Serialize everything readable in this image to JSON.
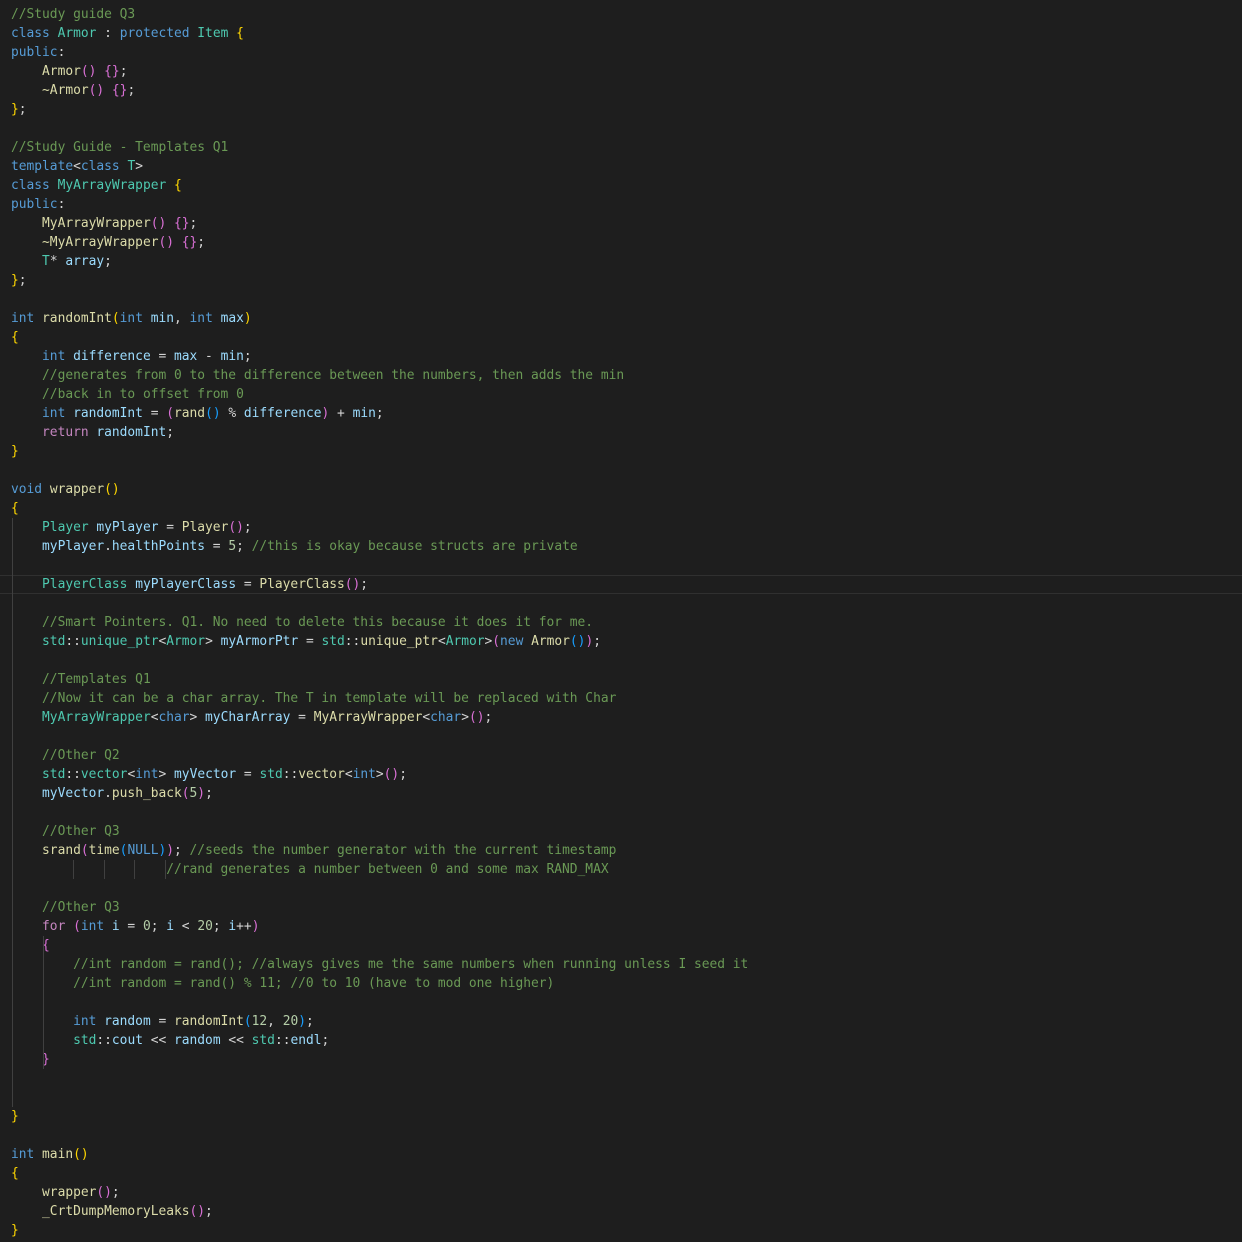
{
  "editor": {
    "language": "cpp",
    "theme_colors": {
      "background": "#1e1e1e",
      "comment": "#6a9955",
      "keyword": "#569cd6",
      "control": "#c586c0",
      "type": "#4ec9b0",
      "function": "#dcdcaa",
      "variable": "#9cdcfe",
      "number": "#b5cea8",
      "text": "#d4d4d4",
      "bracket_1": "#ffd700",
      "bracket_2": "#da70d6",
      "bracket_3": "#179fff"
    },
    "current_line": 30,
    "lines": [
      [
        [
          "c",
          "//Study guide Q3"
        ]
      ],
      [
        [
          "k",
          "class "
        ],
        [
          "y",
          "Armor"
        ],
        [
          "t",
          " : "
        ],
        [
          "k",
          "protected "
        ],
        [
          "y",
          "Item "
        ],
        [
          "b1",
          "{"
        ]
      ],
      [
        [
          "k",
          "public"
        ],
        [
          "t",
          ":"
        ]
      ],
      [
        [
          "t",
          "    "
        ],
        [
          "f",
          "Armor"
        ],
        [
          "b2",
          "()"
        ],
        [
          "t",
          " "
        ],
        [
          "b2",
          "{}"
        ],
        [
          "t",
          ";"
        ]
      ],
      [
        [
          "t",
          "    "
        ],
        [
          "f",
          "~Armor"
        ],
        [
          "b2",
          "()"
        ],
        [
          "t",
          " "
        ],
        [
          "b2",
          "{}"
        ],
        [
          "t",
          ";"
        ]
      ],
      [
        [
          "b1",
          "}"
        ],
        [
          "t",
          ";"
        ]
      ],
      [],
      [
        [
          "c",
          "//Study Guide - Templates Q1"
        ]
      ],
      [
        [
          "k",
          "template"
        ],
        [
          "t",
          "<"
        ],
        [
          "k",
          "class "
        ],
        [
          "y",
          "T"
        ],
        [
          "t",
          ">"
        ]
      ],
      [
        [
          "k",
          "class "
        ],
        [
          "y",
          "MyArrayWrapper "
        ],
        [
          "b1",
          "{"
        ]
      ],
      [
        [
          "k",
          "public"
        ],
        [
          "t",
          ":"
        ]
      ],
      [
        [
          "t",
          "    "
        ],
        [
          "f",
          "MyArrayWrapper"
        ],
        [
          "b2",
          "()"
        ],
        [
          "t",
          " "
        ],
        [
          "b2",
          "{}"
        ],
        [
          "t",
          ";"
        ]
      ],
      [
        [
          "t",
          "    "
        ],
        [
          "f",
          "~MyArrayWrapper"
        ],
        [
          "b2",
          "()"
        ],
        [
          "t",
          " "
        ],
        [
          "b2",
          "{}"
        ],
        [
          "t",
          ";"
        ]
      ],
      [
        [
          "t",
          "    "
        ],
        [
          "y",
          "T"
        ],
        [
          "t",
          "* "
        ],
        [
          "v",
          "array"
        ],
        [
          "t",
          ";"
        ]
      ],
      [
        [
          "b1",
          "}"
        ],
        [
          "t",
          ";"
        ]
      ],
      [],
      [
        [
          "k",
          "int "
        ],
        [
          "f",
          "randomInt"
        ],
        [
          "b1",
          "("
        ],
        [
          "k",
          "int "
        ],
        [
          "v",
          "min"
        ],
        [
          "t",
          ", "
        ],
        [
          "k",
          "int "
        ],
        [
          "v",
          "max"
        ],
        [
          "b1",
          ")"
        ]
      ],
      [
        [
          "b1",
          "{"
        ]
      ],
      [
        [
          "t",
          "    "
        ],
        [
          "k",
          "int "
        ],
        [
          "v",
          "difference"
        ],
        [
          "t",
          " = "
        ],
        [
          "v",
          "max"
        ],
        [
          "t",
          " - "
        ],
        [
          "v",
          "min"
        ],
        [
          "t",
          ";"
        ]
      ],
      [
        [
          "t",
          "    "
        ],
        [
          "c",
          "//generates from 0 to the difference between the numbers, then adds the min"
        ]
      ],
      [
        [
          "t",
          "    "
        ],
        [
          "c",
          "//back in to offset from 0"
        ]
      ],
      [
        [
          "t",
          "    "
        ],
        [
          "k",
          "int "
        ],
        [
          "v",
          "randomInt"
        ],
        [
          "t",
          " = "
        ],
        [
          "b2",
          "("
        ],
        [
          "f",
          "rand"
        ],
        [
          "b3",
          "()"
        ],
        [
          "t",
          " % "
        ],
        [
          "v",
          "difference"
        ],
        [
          "b2",
          ")"
        ],
        [
          "t",
          " + "
        ],
        [
          "v",
          "min"
        ],
        [
          "t",
          ";"
        ]
      ],
      [
        [
          "t",
          "    "
        ],
        [
          "p",
          "return "
        ],
        [
          "v",
          "randomInt"
        ],
        [
          "t",
          ";"
        ]
      ],
      [
        [
          "b1",
          "}"
        ]
      ],
      [],
      [
        [
          "k",
          "void "
        ],
        [
          "f",
          "wrapper"
        ],
        [
          "b1",
          "()"
        ]
      ],
      [
        [
          "b1",
          "{"
        ]
      ],
      [
        [
          "t",
          "    "
        ],
        [
          "y",
          "Player "
        ],
        [
          "v",
          "myPlayer"
        ],
        [
          "t",
          " = "
        ],
        [
          "f",
          "Player"
        ],
        [
          "b2",
          "()"
        ],
        [
          "t",
          ";"
        ]
      ],
      [
        [
          "t",
          "    "
        ],
        [
          "v",
          "myPlayer"
        ],
        [
          "t",
          "."
        ],
        [
          "v",
          "healthPoints"
        ],
        [
          "t",
          " = "
        ],
        [
          "n",
          "5"
        ],
        [
          "t",
          "; "
        ],
        [
          "c",
          "//this is okay because structs are private"
        ]
      ],
      [],
      [
        [
          "t",
          "    "
        ],
        [
          "y",
          "PlayerClass "
        ],
        [
          "v",
          "myPlayerClass"
        ],
        [
          "t",
          " = "
        ],
        [
          "f",
          "PlayerClass"
        ],
        [
          "b2",
          "()"
        ],
        [
          "t",
          ";"
        ]
      ],
      [],
      [
        [
          "t",
          "    "
        ],
        [
          "c",
          "//Smart Pointers. Q1. No need to delete this because it does it for me."
        ]
      ],
      [
        [
          "t",
          "    "
        ],
        [
          "y",
          "std"
        ],
        [
          "t",
          "::"
        ],
        [
          "y",
          "unique_ptr"
        ],
        [
          "t",
          "<"
        ],
        [
          "y",
          "Armor"
        ],
        [
          "t",
          "> "
        ],
        [
          "v",
          "myArmorPtr"
        ],
        [
          "t",
          " = "
        ],
        [
          "y",
          "std"
        ],
        [
          "t",
          "::"
        ],
        [
          "f",
          "unique_ptr"
        ],
        [
          "t",
          "<"
        ],
        [
          "y",
          "Armor"
        ],
        [
          "t",
          ">"
        ],
        [
          "b2",
          "("
        ],
        [
          "k",
          "new "
        ],
        [
          "f",
          "Armor"
        ],
        [
          "b3",
          "()"
        ],
        [
          "b2",
          ")"
        ],
        [
          "t",
          ";"
        ]
      ],
      [],
      [
        [
          "t",
          "    "
        ],
        [
          "c",
          "//Templates Q1"
        ]
      ],
      [
        [
          "t",
          "    "
        ],
        [
          "c",
          "//Now it can be a char array. The T in template will be replaced with Char"
        ]
      ],
      [
        [
          "t",
          "    "
        ],
        [
          "y",
          "MyArrayWrapper"
        ],
        [
          "t",
          "<"
        ],
        [
          "k",
          "char"
        ],
        [
          "t",
          "> "
        ],
        [
          "v",
          "myCharArray"
        ],
        [
          "t",
          " = "
        ],
        [
          "f",
          "MyArrayWrapper"
        ],
        [
          "t",
          "<"
        ],
        [
          "k",
          "char"
        ],
        [
          "t",
          ">"
        ],
        [
          "b2",
          "()"
        ],
        [
          "t",
          ";"
        ]
      ],
      [],
      [
        [
          "t",
          "    "
        ],
        [
          "c",
          "//Other Q2"
        ]
      ],
      [
        [
          "t",
          "    "
        ],
        [
          "y",
          "std"
        ],
        [
          "t",
          "::"
        ],
        [
          "y",
          "vector"
        ],
        [
          "t",
          "<"
        ],
        [
          "k",
          "int"
        ],
        [
          "t",
          "> "
        ],
        [
          "v",
          "myVector"
        ],
        [
          "t",
          " = "
        ],
        [
          "y",
          "std"
        ],
        [
          "t",
          "::"
        ],
        [
          "f",
          "vector"
        ],
        [
          "t",
          "<"
        ],
        [
          "k",
          "int"
        ],
        [
          "t",
          ">"
        ],
        [
          "b2",
          "()"
        ],
        [
          "t",
          ";"
        ]
      ],
      [
        [
          "t",
          "    "
        ],
        [
          "v",
          "myVector"
        ],
        [
          "t",
          "."
        ],
        [
          "f",
          "push_back"
        ],
        [
          "b2",
          "("
        ],
        [
          "n",
          "5"
        ],
        [
          "b2",
          ")"
        ],
        [
          "t",
          ";"
        ]
      ],
      [],
      [
        [
          "t",
          "    "
        ],
        [
          "c",
          "//Other Q3"
        ]
      ],
      [
        [
          "t",
          "    "
        ],
        [
          "f",
          "srand"
        ],
        [
          "b2",
          "("
        ],
        [
          "f",
          "time"
        ],
        [
          "b3",
          "("
        ],
        [
          "k",
          "NULL"
        ],
        [
          "b3",
          ")"
        ],
        [
          "b2",
          ")"
        ],
        [
          "t",
          "; "
        ],
        [
          "c",
          "//seeds the number generator with the current timestamp"
        ]
      ],
      [
        [
          "t",
          "                    "
        ],
        [
          "c",
          "//rand generates a number between 0 and some max RAND_MAX"
        ]
      ],
      [],
      [
        [
          "t",
          "    "
        ],
        [
          "c",
          "//Other Q3"
        ]
      ],
      [
        [
          "t",
          "    "
        ],
        [
          "p",
          "for "
        ],
        [
          "b2",
          "("
        ],
        [
          "k",
          "int "
        ],
        [
          "v",
          "i"
        ],
        [
          "t",
          " = "
        ],
        [
          "n",
          "0"
        ],
        [
          "t",
          "; "
        ],
        [
          "v",
          "i"
        ],
        [
          "t",
          " < "
        ],
        [
          "n",
          "20"
        ],
        [
          "t",
          "; "
        ],
        [
          "v",
          "i"
        ],
        [
          "t",
          "++"
        ],
        [
          "b2",
          ")"
        ]
      ],
      [
        [
          "t",
          "    "
        ],
        [
          "b2",
          "{"
        ]
      ],
      [
        [
          "t",
          "        "
        ],
        [
          "c",
          "//int random = rand(); //always gives me the same numbers when running unless I seed it"
        ]
      ],
      [
        [
          "t",
          "        "
        ],
        [
          "c",
          "//int random = rand() % 11; //0 to 10 (have to mod one higher)"
        ]
      ],
      [],
      [
        [
          "t",
          "        "
        ],
        [
          "k",
          "int "
        ],
        [
          "v",
          "random"
        ],
        [
          "t",
          " = "
        ],
        [
          "f",
          "randomInt"
        ],
        [
          "b3",
          "("
        ],
        [
          "n",
          "12"
        ],
        [
          "t",
          ", "
        ],
        [
          "n",
          "20"
        ],
        [
          "b3",
          ")"
        ],
        [
          "t",
          ";"
        ]
      ],
      [
        [
          "t",
          "        "
        ],
        [
          "y",
          "std"
        ],
        [
          "t",
          "::"
        ],
        [
          "v",
          "cout"
        ],
        [
          "t",
          " << "
        ],
        [
          "v",
          "random"
        ],
        [
          "t",
          " << "
        ],
        [
          "y",
          "std"
        ],
        [
          "t",
          "::"
        ],
        [
          "v",
          "endl"
        ],
        [
          "t",
          ";"
        ]
      ],
      [
        [
          "t",
          "    "
        ],
        [
          "b2",
          "}"
        ]
      ],
      [],
      [],
      [
        [
          "b1",
          "}"
        ]
      ],
      [],
      [
        [
          "k",
          "int "
        ],
        [
          "f",
          "main"
        ],
        [
          "b1",
          "()"
        ]
      ],
      [
        [
          "b1",
          "{"
        ]
      ],
      [
        [
          "t",
          "    "
        ],
        [
          "f",
          "wrapper"
        ],
        [
          "b2",
          "()"
        ],
        [
          "t",
          ";"
        ]
      ],
      [
        [
          "t",
          "    "
        ],
        [
          "f",
          "_CrtDumpMemoryLeaks"
        ],
        [
          "b2",
          "()"
        ],
        [
          "t",
          ";"
        ]
      ],
      [
        [
          "b1",
          "}"
        ]
      ]
    ]
  }
}
